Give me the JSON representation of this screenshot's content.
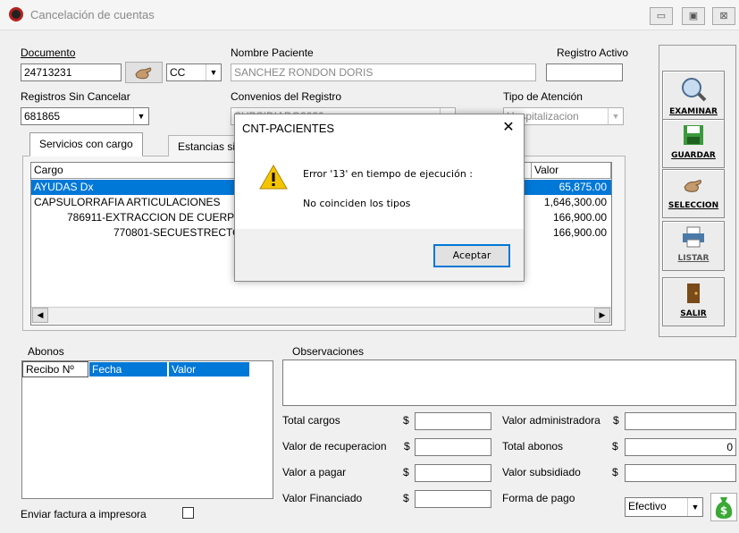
{
  "window": {
    "title": "Cancelación de cuentas",
    "min": "▭",
    "max": "▣",
    "close": "⊠"
  },
  "form": {
    "documento_label": "Documento",
    "documento_value": "24713231",
    "tipo_doc": "CC",
    "nombre_label": "Nombre Paciente",
    "nombre_value": "SANCHEZ RONDON DORIS",
    "registro_activo_label": "Registro Activo",
    "registro_activo_value": "",
    "registros_label": "Registros Sin Cancelar",
    "registros_value": "681865",
    "convenios_label": "Convenios del Registro",
    "convenios_value": "SUBSIDIADO2020",
    "tipo_atencion_label": "Tipo de Atención",
    "tipo_atencion_value": "Hospitalizacion"
  },
  "tabs": [
    "Servicios con cargo",
    "Estancias sin cargo"
  ],
  "services": {
    "headers": {
      "cargo": "Cargo",
      "valor": "Valor"
    },
    "rows": [
      {
        "cargo": "AYUDAS Dx",
        "valor": "65,875.00",
        "selected": true
      },
      {
        "cargo": "CAPSULORRAFIA ARTICULACIONES",
        "valor": "1,646,300.00",
        "selected": false
      },
      {
        "cargo": "786911-EXTRACCION DE CUERPO EXTRAÑO",
        "valor": "166,900.00",
        "selected": false
      },
      {
        "cargo": "770801-SECUESTRECTOMIA",
        "valor": "166,900.00",
        "selected": false
      }
    ],
    "scroll_left": "◀",
    "scroll_right": "▶"
  },
  "abonos": {
    "label": "Abonos",
    "headers": [
      "Recibo Nº",
      "Fecha",
      "Valor"
    ]
  },
  "observaciones": {
    "label": "Observaciones",
    "value": ""
  },
  "totals": {
    "total_cargos": "Total cargos",
    "valor_recuperacion": "Valor de  recuperacion",
    "valor_pagar": "Valor a pagar",
    "valor_financiado": "Valor Financiado",
    "valor_administradora": "Valor administradora",
    "total_abonos": "Total abonos",
    "valor_subsidiado": "Valor subsidiado",
    "forma_pago": "Forma de pago",
    "currency": "$",
    "total_abonos_value": "0",
    "forma_pago_value": "Efectivo"
  },
  "enviar_factura": "Enviar factura a impresora",
  "side_buttons": {
    "examinar": "EXAMINAR",
    "guardar": "GUARDAR",
    "seleccion": "SELECCION",
    "listar": "LISTAR",
    "salir": "SALIR"
  },
  "dialog": {
    "title": "CNT-PACIENTES",
    "close": "✕",
    "line1": "Error '13' en tiempo de ejecución :",
    "line2": "No coinciden los tipos",
    "ok": "Aceptar",
    "icon_glyph": "!"
  },
  "colors": {
    "selection": "#0078d7",
    "warning": "#f5c400",
    "money_green": "#3aa935"
  }
}
